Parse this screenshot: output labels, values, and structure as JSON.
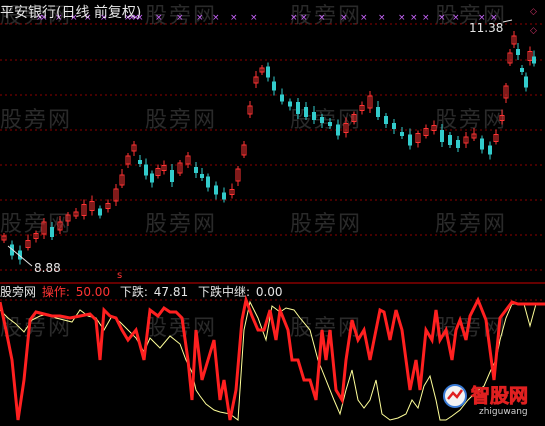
{
  "header": {
    "title": "平安银行(日线 前复权)"
  },
  "price": {
    "high_label": "11.38",
    "low_label": "8.88"
  },
  "indicator": {
    "source": "股旁网",
    "op_label": "操作:",
    "op_value": "50.00",
    "down_label": "下跌:",
    "down_value": "47.81",
    "down_mid_label": "下跌中继:",
    "down_mid_value": "0.00"
  },
  "marker": {
    "small_red": "s"
  },
  "watermark": {
    "text": "股旁网"
  },
  "logo": {
    "text": "智股网",
    "url_text": "zhiguwang"
  },
  "colors": {
    "bg": "#000000",
    "up": "#ff3333",
    "down": "#33cccc",
    "grid": "#8b0000",
    "op_line": "#ff2020",
    "down_line": "#ffff99",
    "marker": "#cc66ff"
  }
}
